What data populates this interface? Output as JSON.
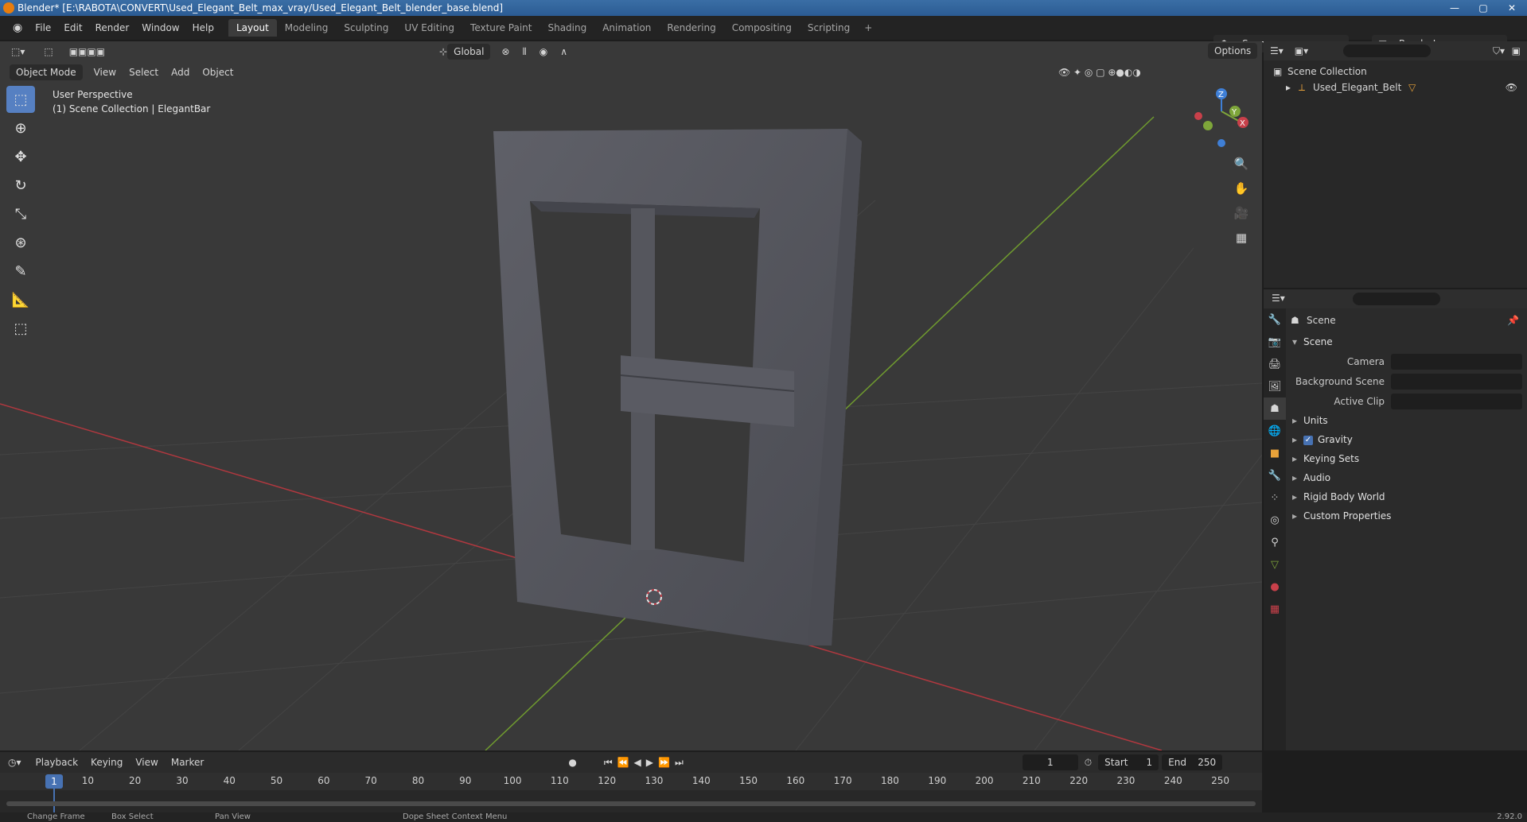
{
  "window": {
    "title": "Blender* [E:\\RABOTA\\CONVERT\\Used_Elegant_Belt_max_vray/Used_Elegant_Belt_blender_base.blend]",
    "controls": [
      "—",
      "▢",
      "✕"
    ]
  },
  "menu": [
    "File",
    "Edit",
    "Render",
    "Window",
    "Help"
  ],
  "workspaces": [
    {
      "label": "Layout",
      "active": true
    },
    {
      "label": "Modeling"
    },
    {
      "label": "Sculpting"
    },
    {
      "label": "UV Editing"
    },
    {
      "label": "Texture Paint"
    },
    {
      "label": "Shading"
    },
    {
      "label": "Animation"
    },
    {
      "label": "Rendering"
    },
    {
      "label": "Compositing"
    },
    {
      "label": "Scripting"
    }
  ],
  "workspace_add": "+",
  "scene_name": "Scene",
  "render_layer": "RenderLayer",
  "viewport": {
    "mode": "Object Mode",
    "menus": [
      "View",
      "Select",
      "Add",
      "Object"
    ],
    "orientation": "Global",
    "options_label": "Options",
    "overlay_title": "User Perspective",
    "overlay_subtitle": "(1) Scene Collection | ElegantBar",
    "gizmo": {
      "x": "X",
      "y": "Y",
      "z": "Z"
    },
    "colors": {
      "x_axis": "#c8404a",
      "y_axis": "#7ea63a",
      "z_axis": "#3f7fd6",
      "background": "#393939"
    }
  },
  "outliner": {
    "root": "Scene Collection",
    "items": [
      "Used_Elegant_Belt"
    ]
  },
  "properties": {
    "context_title": "Scene",
    "section_scene": "Scene",
    "fields": [
      {
        "label": "Camera"
      },
      {
        "label": "Background Scene"
      },
      {
        "label": "Active Clip"
      }
    ],
    "collapsed_sections": [
      "Units",
      "Gravity",
      "Keying Sets",
      "Audio",
      "Rigid Body World",
      "Custom Properties"
    ],
    "gravity_checked": true
  },
  "timeline": {
    "menus": [
      "Playback",
      "Keying",
      "View",
      "Marker"
    ],
    "current_frame": "1",
    "start_label": "Start",
    "start": "1",
    "end_label": "End",
    "end": "250",
    "playhead_label": "1",
    "ticks": [
      "10",
      "20",
      "30",
      "40",
      "50",
      "60",
      "70",
      "80",
      "90",
      "100",
      "110",
      "120",
      "130",
      "140",
      "150",
      "160",
      "170",
      "180",
      "190",
      "200",
      "210",
      "220",
      "230",
      "240",
      "250"
    ]
  },
  "statusbar": {
    "items": [
      "Change Frame",
      "Box Select",
      "Pan View",
      "Dope Sheet Context Menu"
    ],
    "version": "2.92.0"
  }
}
